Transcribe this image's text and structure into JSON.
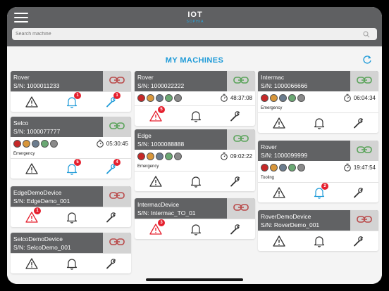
{
  "header": {
    "logo_main": "IOT",
    "logo_sub": "SOPHIA"
  },
  "search": {
    "placeholder": "Search machine"
  },
  "page": {
    "title": "MY MACHINES"
  },
  "colors": {
    "accent": "#1f9bd8",
    "header": "#5f6062",
    "card_head": "#616264",
    "alert": "#e5202e",
    "ok_link": "#5aa35a",
    "broken_link": "#b94a4a"
  },
  "machines": [
    {
      "name": "Rover",
      "sn": "S/N: 1000011233",
      "link": "broken",
      "notif_badge": "1",
      "tool_badge": "1"
    },
    {
      "name": "Selco",
      "sn": "S/N: 1000077777",
      "link": "ok",
      "timer": "05:30:45",
      "tag": "Emergency",
      "notif_badge": "5",
      "tool_badge": "4"
    },
    {
      "name": "EdgeDemoDevice",
      "sn": "S/N: EdgeDemo_001",
      "link": "broken",
      "alarm_badge": "1"
    },
    {
      "name": "SelcoDemoDevice",
      "sn": "S/N: SelcoDemo_001",
      "link": "broken"
    },
    {
      "name": "Rover",
      "sn": "S/N: 1000022222",
      "link": "ok",
      "timer": "48:37:08",
      "alarm_badge": "5"
    },
    {
      "name": "Edge",
      "sn": "S/N: 1000088888",
      "link": "ok",
      "timer": "09:02:22",
      "tag": "Emergency"
    },
    {
      "name": "IntermacDevice",
      "sn": "S/N: Intermac_TO_01",
      "link": "broken",
      "alarm_badge": "3"
    },
    {
      "name": "Intermac",
      "sn": "S/N: 1000066666",
      "link": "ok",
      "timer": "06:04:34",
      "tag": "Emergency"
    },
    {
      "name": "Rover",
      "sn": "S/N: 1000099999",
      "link": "ok",
      "timer": "19:47:54",
      "tag": "Tooling",
      "notif_badge": "2"
    },
    {
      "name": "RoverDemoDevice",
      "sn": "S/N: RoverDemo_001",
      "link": "broken"
    }
  ]
}
